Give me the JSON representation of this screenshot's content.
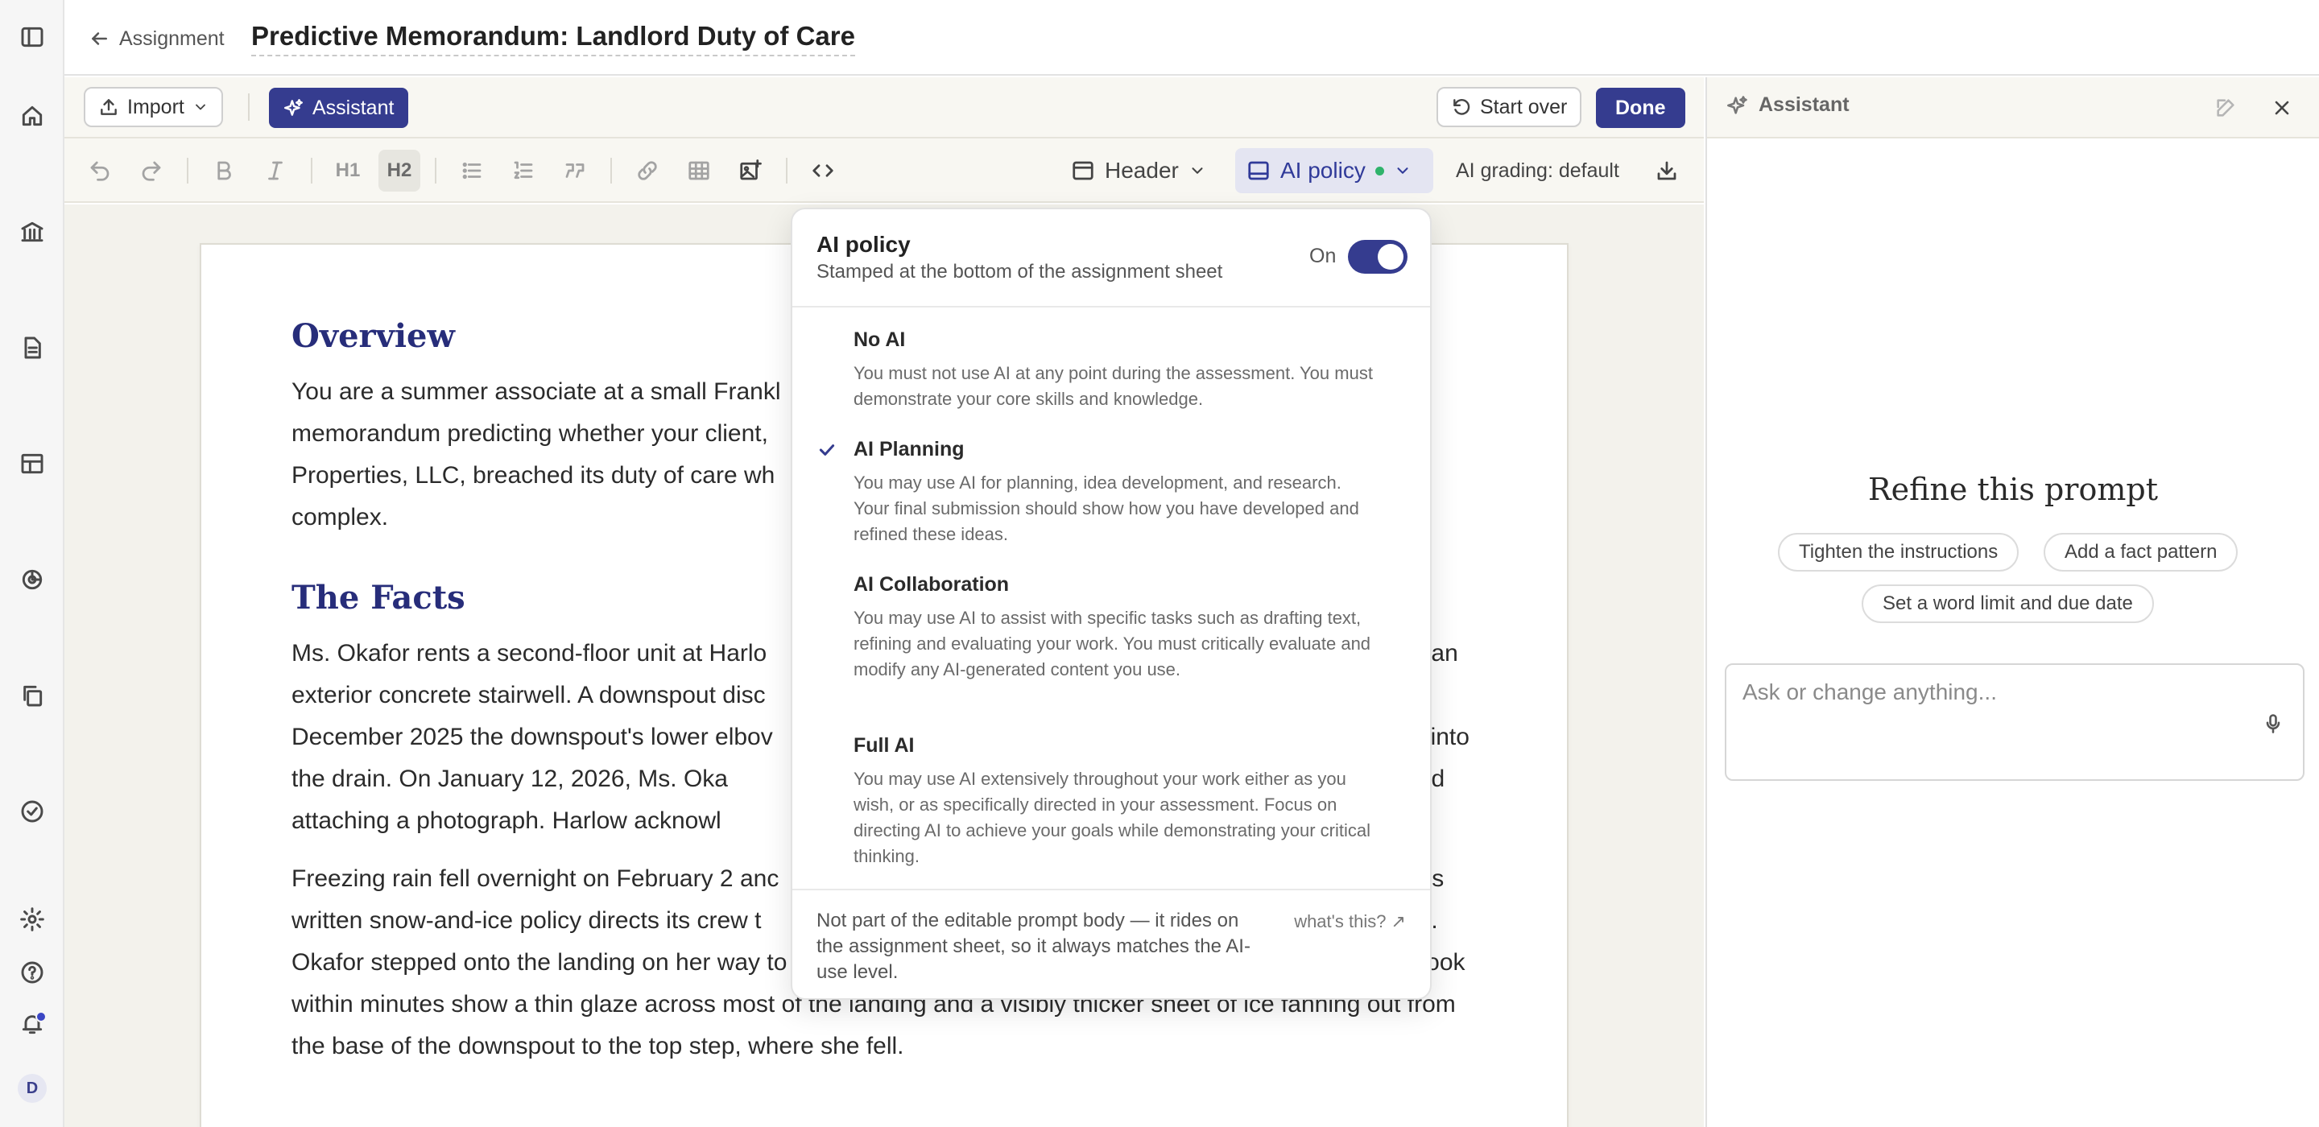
{
  "header": {
    "back_label": "Assignment",
    "title": "Predictive Memorandum: Landlord Duty of Care"
  },
  "toolbar": {
    "import_label": "Import",
    "assistant_label": "Assistant",
    "start_over_label": "Start over",
    "done_label": "Done",
    "heading1_label": "H1",
    "heading2_label": "H2",
    "header_dropdown_label": "Header",
    "ai_policy_label": "AI policy",
    "ai_grading_label": "AI grading: default"
  },
  "document": {
    "sections": [
      {
        "heading": "Overview",
        "paragraphs": [
          "You are a summer associate at a small Frankl                                                                                        tive memorandum predicting whether your client,                                                                                              Properties, LLC, breached its duty of care wh                                                                                                complex."
        ]
      },
      {
        "heading": "The Facts",
        "paragraphs": [
          "Ms. Okafor rents a second-floor unit at Harlo                                                                                                   an exterior concrete stairwell. A downspout disc                                                                                        y December 2025 the downspout's lower elbov                                                                                              of into the drain. On January 12, 2026, Ms. Oka                                                                                              eak and attaching a photograph. Harlow acknowl                                                                                        repaired.",
          "Freezing rain fell overnight on February 2 anc                                                                                              w's written snow-and-ice policy directs its crew t                                                                                          n., Ms. Okafor stepped onto the landing on her way to work and fell, fracturing her wrist. Photographs a neighbor took within minutes show a thin glaze across most of the landing and a visibly thicker sheet of ice fanning out from the base of the downspout to the top step, where she fell."
        ]
      }
    ]
  },
  "ai_policy_popover": {
    "title": "AI policy",
    "subtitle": "Stamped at the bottom of the assignment sheet",
    "toggle_label": "On",
    "toggle_on": true,
    "selected": "AI Planning",
    "options": [
      {
        "title": "No AI",
        "description": "You must not use AI at any point during the assessment. You must demonstrate your core skills and knowledge.",
        "selected": false
      },
      {
        "title": "AI Planning",
        "description": "You may use AI for planning, idea development, and research. Your final submission should show how you have developed and refined these ideas.",
        "selected": true
      },
      {
        "title": "AI Collaboration",
        "description": "You may use AI to assist with specific tasks such as drafting text, refining and evaluating your work. You must critically evaluate and modify any AI-generated content you use.",
        "selected": false
      },
      {
        "title": "Full AI",
        "description": "You may use AI extensively throughout your work either as you wish, or as specifically directed in your assessment. Focus on directing AI to achieve your goals while demonstrating your critical thinking.",
        "selected": false
      }
    ],
    "footer_text": "Not part of the editable prompt body — it rides on the assignment sheet, so it always matches the AI-use level.",
    "footer_link": "what's this? ↗"
  },
  "assistant_panel": {
    "title": "Assistant",
    "refine_title": "Refine this prompt",
    "suggestions": [
      "Tighten the instructions",
      "Add a fact pattern",
      "Set a word limit and due date"
    ],
    "input_placeholder": "Ask or change anything..."
  },
  "sidebar": {
    "avatar_initial": "D",
    "icons": [
      "sidebar-toggle-icon",
      "home-icon",
      "institution-icon",
      "document-icon",
      "table-icon",
      "analytics-icon",
      "copy-icon",
      "check-circle-icon",
      "gear-icon",
      "help-icon",
      "bell-icon"
    ]
  },
  "colors": {
    "accent": "#353c8f",
    "heading": "#272d7a",
    "status_green": "#2fb36b",
    "notification_dot": "#3b46c4"
  }
}
